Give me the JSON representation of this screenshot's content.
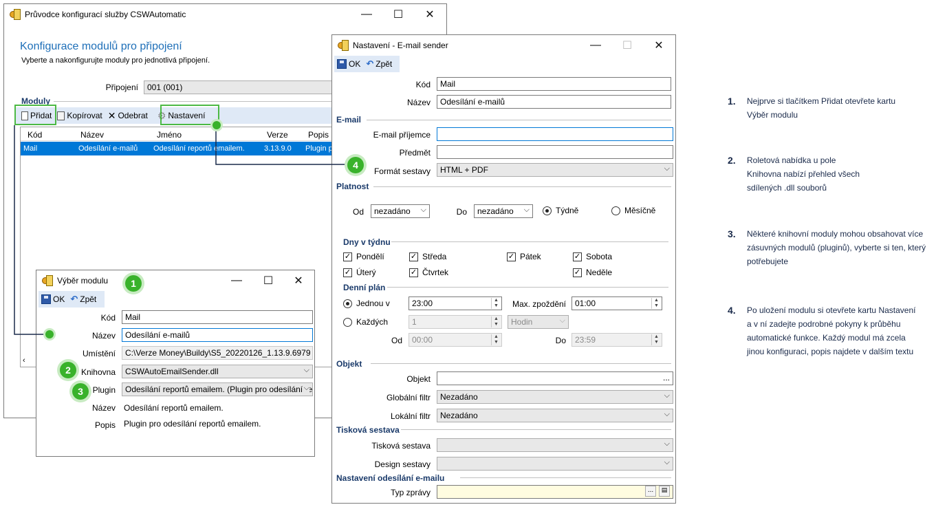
{
  "main_window": {
    "title": "Průvodce konfigurací služby CSWAutomatic",
    "heading": "Konfigurace modulů pro připojení",
    "subheading": "Vyberte a nakonfigurujte moduly pro jednotlivá připojení.",
    "connection_label": "Připojení",
    "connection_value": "001 (001)",
    "modules_label": "Moduly",
    "toolbar": {
      "add": "Přidat",
      "copy": "Kopírovat",
      "remove": "Odebrat",
      "settings": "Nastavení"
    },
    "columns": [
      "Kód",
      "Název",
      "Jméno",
      "Verze",
      "Popis"
    ],
    "rows": [
      {
        "kod": "Mail",
        "nazev": "Odesílání e-mailů",
        "jmeno": "Odesílání reportů emailem.",
        "verze": "3.13.9.0",
        "popis": "Plugin pr"
      }
    ]
  },
  "select_window": {
    "title": "Výběr modulu",
    "ok": "OK",
    "back": "Zpět",
    "fields": {
      "kod_label": "Kód",
      "kod_value": "Mail",
      "nazev_label": "Název",
      "nazev_value": "Odesílání e-mailů",
      "umisteni_label": "Umístění",
      "umisteni_value": "C:\\Verze Money\\Buildy\\S5_20220126_1.13.9.6979",
      "knihovna_label": "Knihovna",
      "knihovna_value": "CSWAutoEmailSender.dll",
      "plugin_label": "Plugin",
      "plugin_value": "Odesílání reportů emailem. (Plugin pro odesílání repor",
      "pnazev_label": "Název",
      "pnazev_value": "Odesílání reportů emailem.",
      "popis_label": "Popis",
      "popis_value": "Plugin pro odesílání reportů emailem."
    }
  },
  "settings_window": {
    "title": "Nastavení - E-mail sender",
    "ok": "OK",
    "back": "Zpět",
    "kod_label": "Kód",
    "kod_value": "Mail",
    "nazev_label": "Název",
    "nazev_value": "Odesílání e-mailů",
    "email_section": "E-mail",
    "prijemce_label": "E-mail příjemce",
    "predmet_label": "Předmět",
    "format_label": "Formát sestavy",
    "format_value": "HTML + PDF",
    "platnost_section": "Platnost",
    "od_label": "Od",
    "od_value": "nezadáno",
    "do_label": "Do",
    "do_value": "nezadáno",
    "tydne": "Týdně",
    "mesicne": "Měsíčně",
    "dny_section": "Dny v týdnu",
    "days": {
      "po": "Pondělí",
      "st": "Středa",
      "pa": "Pátek",
      "so": "Sobota",
      "ut": "Úterý",
      "ct": "Čtvrtek",
      "ne": "Neděle"
    },
    "plan_section": "Denní plán",
    "jednou": "Jednou v",
    "jednou_value": "23:00",
    "max_label": "Max. zpoždění",
    "max_value": "01:00",
    "kazdych": "Každých",
    "kazdych_value": "1",
    "hodin": "Hodin",
    "plan_od_label": "Od",
    "plan_od_value": "00:00",
    "plan_do_label": "Do",
    "plan_do_value": "23:59",
    "objekt_section": "Objekt",
    "objekt_label": "Objekt",
    "objekt_btn": "...",
    "globalni_label": "Globální filtr",
    "globalni_value": "Nezadáno",
    "lokalni_label": "Lokální filtr",
    "lokalni_value": "Nezadáno",
    "tiskova_section": "Tisková sestava",
    "tiskova_label": "Tisková sestava",
    "design_label": "Design sestavy",
    "odesilani_section": "Nastavení odesílání e-mailu",
    "typ_label": "Typ zprávy",
    "typ_btn": "..."
  },
  "badges": [
    "1",
    "2",
    "3",
    "4"
  ],
  "notes": [
    {
      "num": "1.",
      "text": "Nejprve si tlačítkem Přidat otevřete kartu Výběr modulu"
    },
    {
      "num": "2.",
      "text": "Roletová nabídka u pole Knihovna nabízí přehled všech sdílených .dll souborů"
    },
    {
      "num": "3.",
      "text": "Některé knihovní moduly mohou obsahovat více zásuvných modulů (pluginů), vyberte si ten, který potřebujete"
    },
    {
      "num": "4.",
      "text": "Po uložení modulu si otevřete kartu Nastavení a v ní zadejte podrobné pokyny k průběhu automatické funkce. Každý modul má zcela jinou konfiguraci, popis najdete v dalším textu"
    }
  ],
  "colors": {
    "accent_green": "#39b22b",
    "selection_blue": "#0078d7",
    "toolbar_blue": "#dfe9f6",
    "heading_blue": "#1e6fb8"
  }
}
